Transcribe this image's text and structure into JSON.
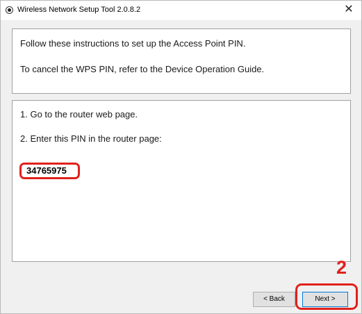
{
  "window": {
    "title": "Wireless Network Setup Tool 2.0.8.2",
    "close_glyph": "✕",
    "icon": "app-disc-icon"
  },
  "instructions": {
    "line1": "Follow these instructions to set up the Access Point PIN.",
    "line2": "To cancel the WPS PIN, refer to the Device Operation Guide."
  },
  "steps": {
    "step1": "1. Go to the router web page.",
    "step2": "2. Enter this PIN in the router page:",
    "pin": "34765975"
  },
  "callout": {
    "number": "2",
    "color": "#e0201b"
  },
  "buttons": {
    "back": "< Back",
    "next": "Next >"
  }
}
